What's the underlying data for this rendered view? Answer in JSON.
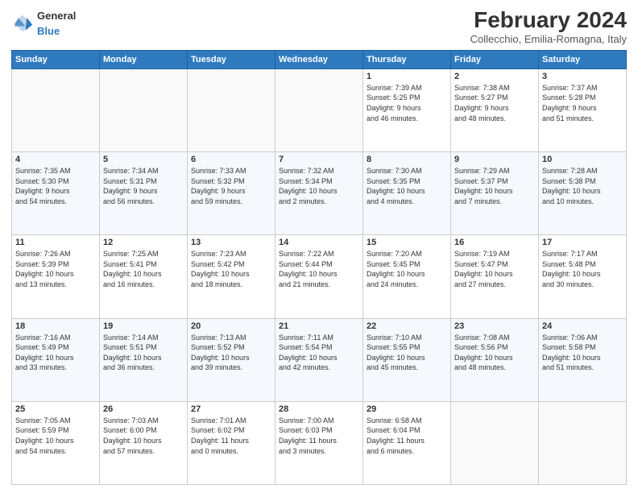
{
  "logo": {
    "line1": "General",
    "line2": "Blue"
  },
  "title": "February 2024",
  "subtitle": "Collecchio, Emilia-Romagna, Italy",
  "weekdays": [
    "Sunday",
    "Monday",
    "Tuesday",
    "Wednesday",
    "Thursday",
    "Friday",
    "Saturday"
  ],
  "weeks": [
    [
      {
        "day": "",
        "info": ""
      },
      {
        "day": "",
        "info": ""
      },
      {
        "day": "",
        "info": ""
      },
      {
        "day": "",
        "info": ""
      },
      {
        "day": "1",
        "info": "Sunrise: 7:39 AM\nSunset: 5:25 PM\nDaylight: 9 hours\nand 46 minutes."
      },
      {
        "day": "2",
        "info": "Sunrise: 7:38 AM\nSunset: 5:27 PM\nDaylight: 9 hours\nand 48 minutes."
      },
      {
        "day": "3",
        "info": "Sunrise: 7:37 AM\nSunset: 5:28 PM\nDaylight: 9 hours\nand 51 minutes."
      }
    ],
    [
      {
        "day": "4",
        "info": "Sunrise: 7:35 AM\nSunset: 5:30 PM\nDaylight: 9 hours\nand 54 minutes."
      },
      {
        "day": "5",
        "info": "Sunrise: 7:34 AM\nSunset: 5:31 PM\nDaylight: 9 hours\nand 56 minutes."
      },
      {
        "day": "6",
        "info": "Sunrise: 7:33 AM\nSunset: 5:32 PM\nDaylight: 9 hours\nand 59 minutes."
      },
      {
        "day": "7",
        "info": "Sunrise: 7:32 AM\nSunset: 5:34 PM\nDaylight: 10 hours\nand 2 minutes."
      },
      {
        "day": "8",
        "info": "Sunrise: 7:30 AM\nSunset: 5:35 PM\nDaylight: 10 hours\nand 4 minutes."
      },
      {
        "day": "9",
        "info": "Sunrise: 7:29 AM\nSunset: 5:37 PM\nDaylight: 10 hours\nand 7 minutes."
      },
      {
        "day": "10",
        "info": "Sunrise: 7:28 AM\nSunset: 5:38 PM\nDaylight: 10 hours\nand 10 minutes."
      }
    ],
    [
      {
        "day": "11",
        "info": "Sunrise: 7:26 AM\nSunset: 5:39 PM\nDaylight: 10 hours\nand 13 minutes."
      },
      {
        "day": "12",
        "info": "Sunrise: 7:25 AM\nSunset: 5:41 PM\nDaylight: 10 hours\nand 16 minutes."
      },
      {
        "day": "13",
        "info": "Sunrise: 7:23 AM\nSunset: 5:42 PM\nDaylight: 10 hours\nand 18 minutes."
      },
      {
        "day": "14",
        "info": "Sunrise: 7:22 AM\nSunset: 5:44 PM\nDaylight: 10 hours\nand 21 minutes."
      },
      {
        "day": "15",
        "info": "Sunrise: 7:20 AM\nSunset: 5:45 PM\nDaylight: 10 hours\nand 24 minutes."
      },
      {
        "day": "16",
        "info": "Sunrise: 7:19 AM\nSunset: 5:47 PM\nDaylight: 10 hours\nand 27 minutes."
      },
      {
        "day": "17",
        "info": "Sunrise: 7:17 AM\nSunset: 5:48 PM\nDaylight: 10 hours\nand 30 minutes."
      }
    ],
    [
      {
        "day": "18",
        "info": "Sunrise: 7:16 AM\nSunset: 5:49 PM\nDaylight: 10 hours\nand 33 minutes."
      },
      {
        "day": "19",
        "info": "Sunrise: 7:14 AM\nSunset: 5:51 PM\nDaylight: 10 hours\nand 36 minutes."
      },
      {
        "day": "20",
        "info": "Sunrise: 7:13 AM\nSunset: 5:52 PM\nDaylight: 10 hours\nand 39 minutes."
      },
      {
        "day": "21",
        "info": "Sunrise: 7:11 AM\nSunset: 5:54 PM\nDaylight: 10 hours\nand 42 minutes."
      },
      {
        "day": "22",
        "info": "Sunrise: 7:10 AM\nSunset: 5:55 PM\nDaylight: 10 hours\nand 45 minutes."
      },
      {
        "day": "23",
        "info": "Sunrise: 7:08 AM\nSunset: 5:56 PM\nDaylight: 10 hours\nand 48 minutes."
      },
      {
        "day": "24",
        "info": "Sunrise: 7:06 AM\nSunset: 5:58 PM\nDaylight: 10 hours\nand 51 minutes."
      }
    ],
    [
      {
        "day": "25",
        "info": "Sunrise: 7:05 AM\nSunset: 5:59 PM\nDaylight: 10 hours\nand 54 minutes."
      },
      {
        "day": "26",
        "info": "Sunrise: 7:03 AM\nSunset: 6:00 PM\nDaylight: 10 hours\nand 57 minutes."
      },
      {
        "day": "27",
        "info": "Sunrise: 7:01 AM\nSunset: 6:02 PM\nDaylight: 11 hours\nand 0 minutes."
      },
      {
        "day": "28",
        "info": "Sunrise: 7:00 AM\nSunset: 6:03 PM\nDaylight: 11 hours\nand 3 minutes."
      },
      {
        "day": "29",
        "info": "Sunrise: 6:58 AM\nSunset: 6:04 PM\nDaylight: 11 hours\nand 6 minutes."
      },
      {
        "day": "",
        "info": ""
      },
      {
        "day": "",
        "info": ""
      }
    ]
  ]
}
